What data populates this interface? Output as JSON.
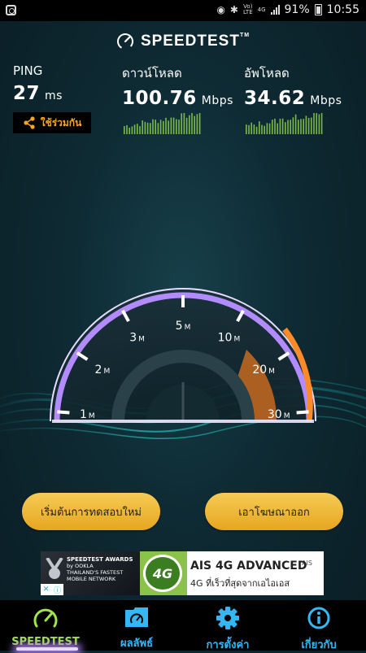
{
  "status_bar": {
    "battery": "91%",
    "time": "10:55",
    "network": "4G",
    "volte_top": "Vo)",
    "volte_bottom": "LTE"
  },
  "app": {
    "title": "SPEEDTEST",
    "tm": "TM"
  },
  "metrics": {
    "ping": {
      "label": "PING",
      "value": "27",
      "unit": "ms"
    },
    "download": {
      "label": "ดาวน์โหลด",
      "value": "100.76",
      "unit": "Mbps"
    },
    "upload": {
      "label": "อัพโหลด",
      "value": "34.62",
      "unit": "Mbps"
    }
  },
  "share_label": "ใช้ร่วมกัน",
  "gauge": {
    "ticks": [
      {
        "num": "1",
        "unit": "M"
      },
      {
        "num": "2",
        "unit": "M"
      },
      {
        "num": "3",
        "unit": "M"
      },
      {
        "num": "5",
        "unit": "M"
      },
      {
        "num": "10",
        "unit": "M"
      },
      {
        "num": "20",
        "unit": "M"
      },
      {
        "num": "30",
        "unit": "M"
      }
    ]
  },
  "buttons": {
    "retest": "เริ่มต้นการทดสอบใหม่",
    "remove_ads": "เอาโฆษณาออก"
  },
  "ad": {
    "award_line1": "SPEEDTEST AWARDS",
    "award_line2": "by OOKLA",
    "award_line3": "THAILAND'S FASTEST",
    "award_line4": "MOBILE NETWORK",
    "badge": "4G",
    "title": "AIS 4G ADVANCED",
    "subtitle": "4G ที่เร็วที่สุดจากเอไอเอส",
    "brand": "AIS"
  },
  "nav": [
    {
      "label": "SPEEDTEST",
      "icon": "speedometer-icon"
    },
    {
      "label": "ผลลัพธ์",
      "icon": "results-folder-icon"
    },
    {
      "label": "การตั้งค่า",
      "icon": "gear-icon"
    },
    {
      "label": "เกี่ยวกับ",
      "icon": "info-icon"
    }
  ],
  "colors": {
    "accent_orange": "#f5a623",
    "nav_blue": "#35b7f4",
    "nav_active": "#9ee54a",
    "spark_green": "#8fd14f",
    "button_gold": "#f2c14a"
  }
}
